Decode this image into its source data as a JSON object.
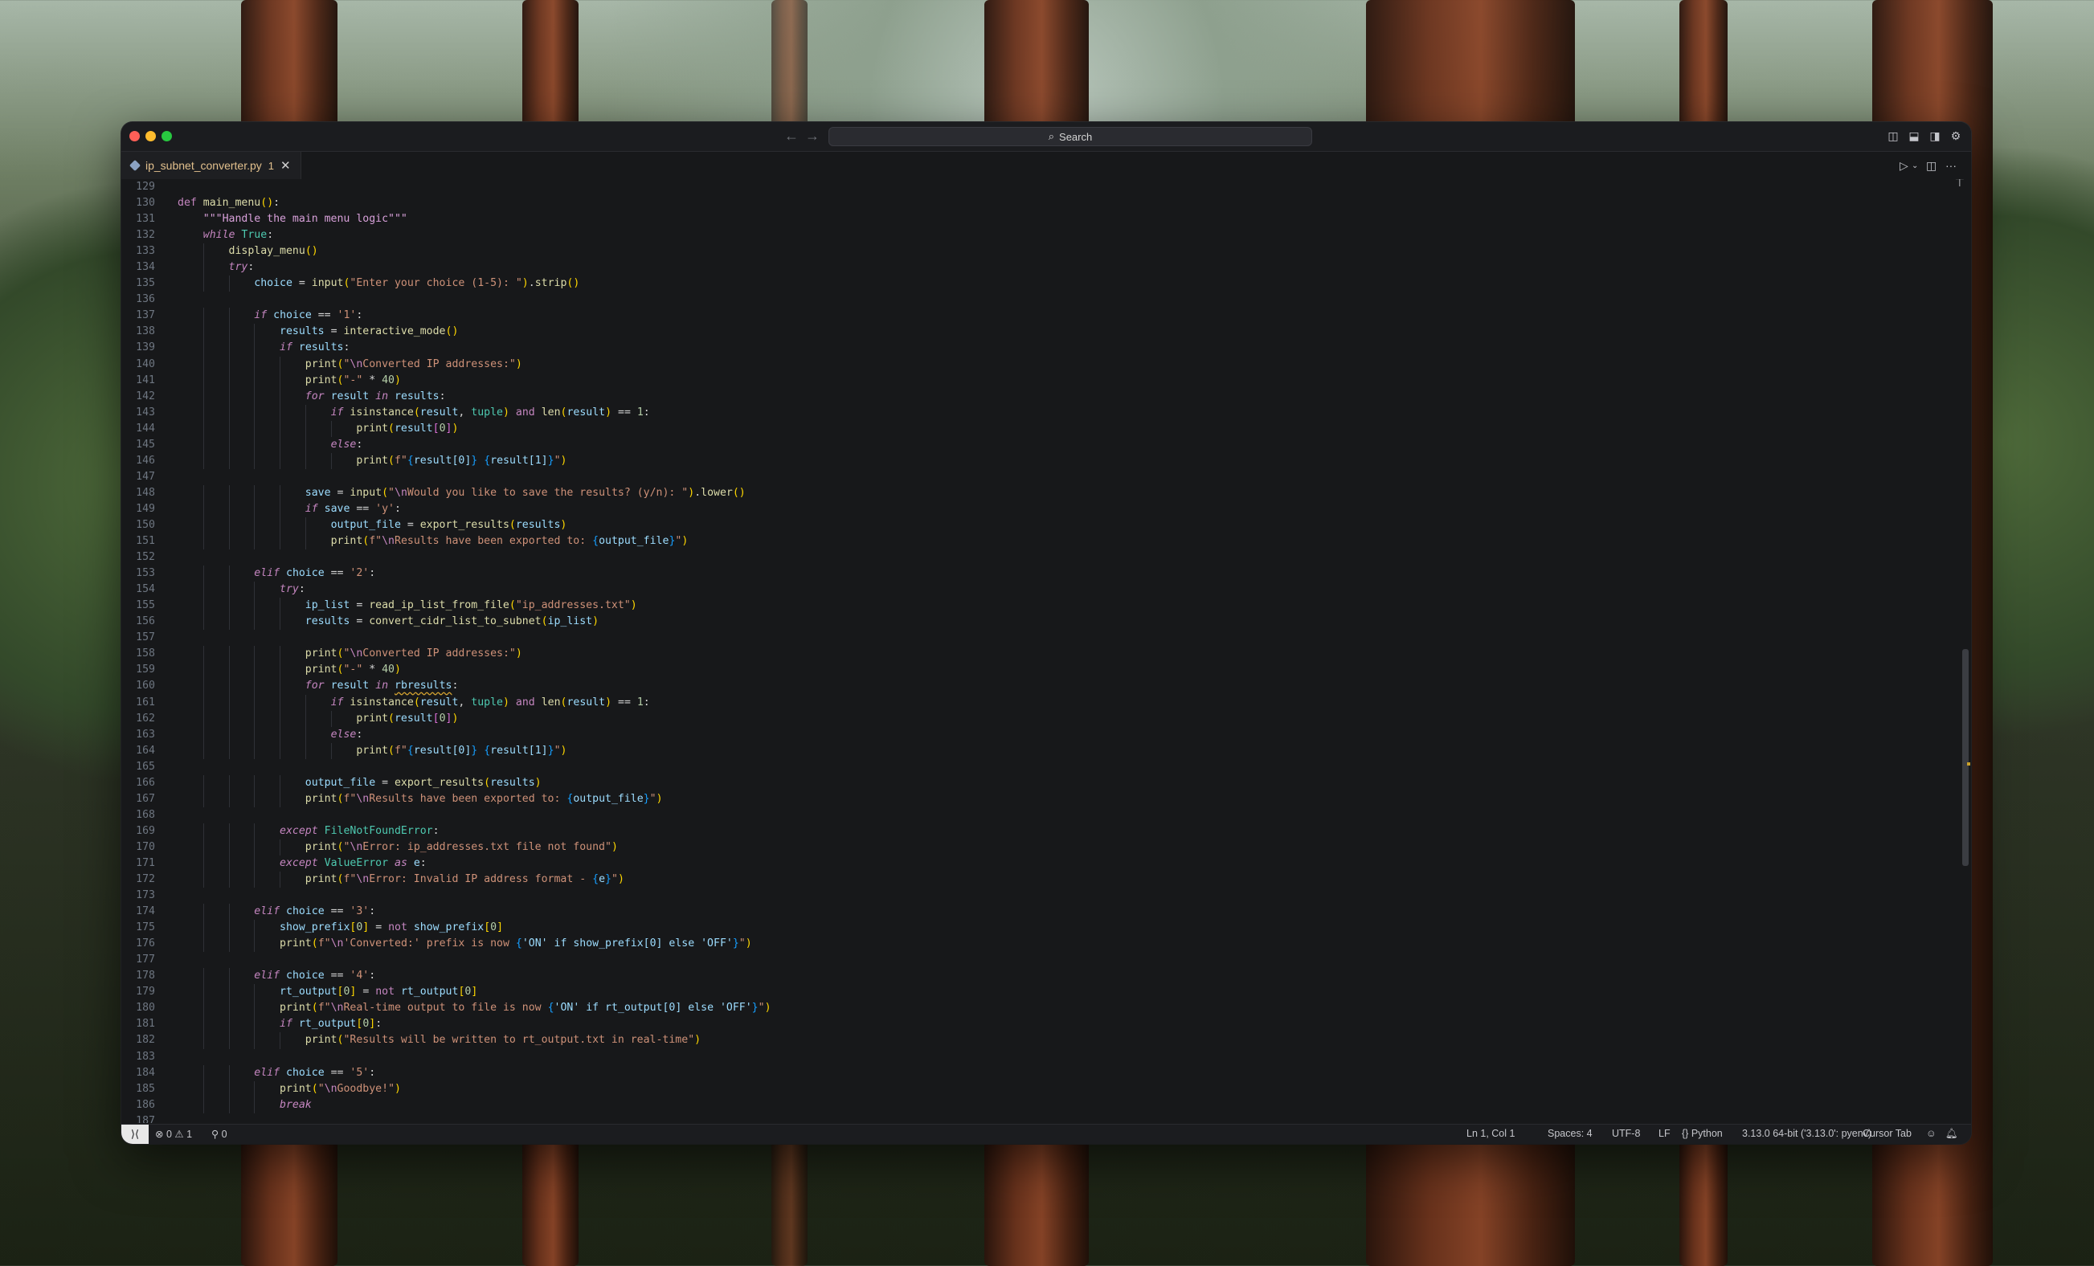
{
  "titlebar": {
    "search_label": "Search"
  },
  "tab": {
    "filename": "ip_subnet_converter.py",
    "problems": "1"
  },
  "statusbar": {
    "errors": "0",
    "warnings": "1",
    "ports": "0",
    "cursor": "Ln 1, Col 1",
    "spaces": "Spaces: 4",
    "encoding": "UTF-8",
    "eol": "LF",
    "language": "Python",
    "interpreter": "3.13.0 64-bit ('3.13.0': pyenv)",
    "cursor_tab": "Cursor Tab"
  },
  "code": [
    {
      "n": "129",
      "t": ""
    },
    {
      "n": "130",
      "t": "def main_menu():"
    },
    {
      "n": "131",
      "t": "    \"\"\"Handle the main menu logic\"\"\""
    },
    {
      "n": "132",
      "t": "    while True:"
    },
    {
      "n": "133",
      "t": "        display_menu()"
    },
    {
      "n": "134",
      "t": "        try:"
    },
    {
      "n": "135",
      "t": "            choice = input(\"Enter your choice (1-5): \").strip()"
    },
    {
      "n": "136",
      "t": ""
    },
    {
      "n": "137",
      "t": "            if choice == '1':"
    },
    {
      "n": "138",
      "t": "                results = interactive_mode()"
    },
    {
      "n": "139",
      "t": "                if results:"
    },
    {
      "n": "140",
      "t": "                    print(\"\\nConverted IP addresses:\")"
    },
    {
      "n": "141",
      "t": "                    print(\"-\" * 40)"
    },
    {
      "n": "142",
      "t": "                    for result in results:"
    },
    {
      "n": "143",
      "t": "                        if isinstance(result, tuple) and len(result) == 1:"
    },
    {
      "n": "144",
      "t": "                            print(result[0])"
    },
    {
      "n": "145",
      "t": "                        else:"
    },
    {
      "n": "146",
      "t": "                            print(f\"{result[0]} {result[1]}\")"
    },
    {
      "n": "147",
      "t": ""
    },
    {
      "n": "148",
      "t": "                    save = input(\"\\nWould you like to save the results? (y/n): \").lower()"
    },
    {
      "n": "149",
      "t": "                    if save == 'y':"
    },
    {
      "n": "150",
      "t": "                        output_file = export_results(results)"
    },
    {
      "n": "151",
      "t": "                        print(f\"\\nResults have been exported to: {output_file}\")"
    },
    {
      "n": "152",
      "t": ""
    },
    {
      "n": "153",
      "t": "            elif choice == '2':"
    },
    {
      "n": "154",
      "t": "                try:"
    },
    {
      "n": "155",
      "t": "                    ip_list = read_ip_list_from_file(\"ip_addresses.txt\")"
    },
    {
      "n": "156",
      "t": "                    results = convert_cidr_list_to_subnet(ip_list)"
    },
    {
      "n": "157",
      "t": ""
    },
    {
      "n": "158",
      "t": "                    print(\"\\nConverted IP addresses:\")"
    },
    {
      "n": "159",
      "t": "                    print(\"-\" * 40)"
    },
    {
      "n": "160",
      "t": "                    for result in rbresults:"
    },
    {
      "n": "161",
      "t": "                        if isinstance(result, tuple) and len(result) == 1:"
    },
    {
      "n": "162",
      "t": "                            print(result[0])"
    },
    {
      "n": "163",
      "t": "                        else:"
    },
    {
      "n": "164",
      "t": "                            print(f\"{result[0]} {result[1]}\")"
    },
    {
      "n": "165",
      "t": ""
    },
    {
      "n": "166",
      "t": "                    output_file = export_results(results)"
    },
    {
      "n": "167",
      "t": "                    print(f\"\\nResults have been exported to: {output_file}\")"
    },
    {
      "n": "168",
      "t": ""
    },
    {
      "n": "169",
      "t": "                except FileNotFoundError:"
    },
    {
      "n": "170",
      "t": "                    print(\"\\nError: ip_addresses.txt file not found\")"
    },
    {
      "n": "171",
      "t": "                except ValueError as e:"
    },
    {
      "n": "172",
      "t": "                    print(f\"\\nError: Invalid IP address format - {e}\")"
    },
    {
      "n": "173",
      "t": ""
    },
    {
      "n": "174",
      "t": "            elif choice == '3':"
    },
    {
      "n": "175",
      "t": "                show_prefix[0] = not show_prefix[0]"
    },
    {
      "n": "176",
      "t": "                print(f\"\\n'Converted:' prefix is now {'ON' if show_prefix[0] else 'OFF'}\")"
    },
    {
      "n": "177",
      "t": ""
    },
    {
      "n": "178",
      "t": "            elif choice == '4':"
    },
    {
      "n": "179",
      "t": "                rt_output[0] = not rt_output[0]"
    },
    {
      "n": "180",
      "t": "                print(f\"\\nReal-time output to file is now {'ON' if rt_output[0] else 'OFF'}\")"
    },
    {
      "n": "181",
      "t": "                if rt_output[0]:"
    },
    {
      "n": "182",
      "t": "                    print(\"Results will be written to rt_output.txt in real-time\")"
    },
    {
      "n": "183",
      "t": ""
    },
    {
      "n": "184",
      "t": "            elif choice == '5':"
    },
    {
      "n": "185",
      "t": "                print(\"\\nGoodbye!\")"
    },
    {
      "n": "186",
      "t": "                break"
    },
    {
      "n": "187",
      "t": ""
    }
  ]
}
